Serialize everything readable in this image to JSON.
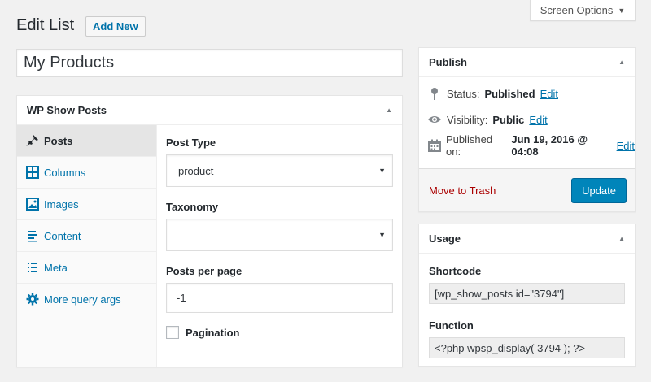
{
  "screen_options": {
    "label": "Screen Options"
  },
  "header": {
    "title": "Edit List",
    "add_new": "Add New"
  },
  "post_title": {
    "value": "My Products"
  },
  "wpsp": {
    "title": "WP Show Posts",
    "tabs": [
      {
        "label": "Posts",
        "icon": "pin-icon",
        "active": true
      },
      {
        "label": "Columns",
        "icon": "columns-icon"
      },
      {
        "label": "Images",
        "icon": "image-icon"
      },
      {
        "label": "Content",
        "icon": "content-icon"
      },
      {
        "label": "Meta",
        "icon": "meta-list-icon"
      },
      {
        "label": "More query args",
        "icon": "gear-icon"
      }
    ],
    "post_type": {
      "label": "Post Type",
      "value": "product"
    },
    "taxonomy": {
      "label": "Taxonomy",
      "value": ""
    },
    "posts_per_page": {
      "label": "Posts per page",
      "value": "-1"
    },
    "pagination": {
      "label": "Pagination",
      "checked": false
    }
  },
  "publish": {
    "title": "Publish",
    "status_label": "Status:",
    "status_value": "Published",
    "visibility_label": "Visibility:",
    "visibility_value": "Public",
    "published_label": "Published on:",
    "published_value": "Jun 19, 2016 @ 04:08",
    "edit_label": "Edit",
    "trash_label": "Move to Trash",
    "update_label": "Update"
  },
  "usage": {
    "title": "Usage",
    "shortcode_label": "Shortcode",
    "shortcode_value": "[wp_show_posts id=\"3794\"]",
    "function_label": "Function",
    "function_value": "<?php wpsp_display( 3794 ); ?>"
  },
  "colors": {
    "link": "#0073aa",
    "primary_button": "#0085ba",
    "trash": "#a00000",
    "background": "#f1f1f1"
  }
}
